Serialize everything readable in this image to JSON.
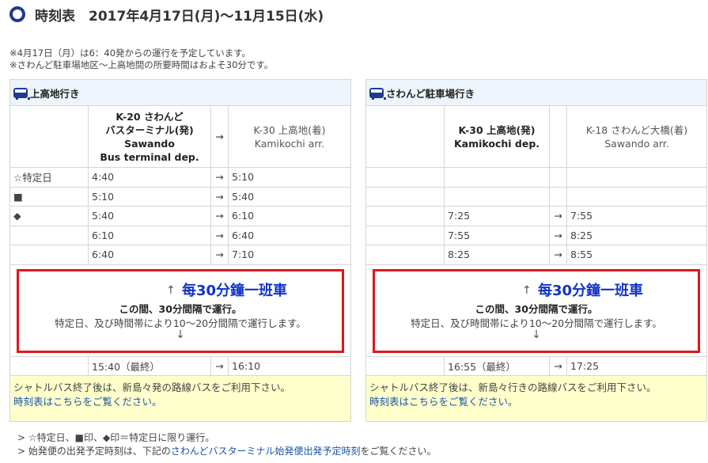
{
  "title": "時刻表　2017年4月17日(月)〜11月15日(水)",
  "notes_top": [
    "※4月17日（月）は6：40発からの運行を予定しています。",
    "※さわんど駐車場地区〜上高地間の所要時間はおよそ30分です。"
  ],
  "left": {
    "header": "上高地行き",
    "dep_col": {
      "line1": "K-20 さわんど",
      "line2": "バスターミナル(発)",
      "line3": "Sawando",
      "line4": "Bus terminal dep."
    },
    "arrow": "→",
    "arr_col": {
      "line1": "K-30 上高地(着)",
      "line2": "Kamikochi arr."
    },
    "rows": [
      {
        "mark": "☆特定日",
        "dep": "4:40",
        "arrow": "→",
        "arr": "5:10"
      },
      {
        "mark": "■",
        "dep": "5:10",
        "arrow": "→",
        "arr": "5:40"
      },
      {
        "mark": "◆",
        "dep": "5:40",
        "arrow": "→",
        "arr": "6:10"
      },
      {
        "mark": "",
        "dep": "6:10",
        "arrow": "→",
        "arr": "6:40"
      },
      {
        "mark": "",
        "dep": "6:40",
        "arrow": "→",
        "arr": "7:10"
      }
    ],
    "middle": {
      "up": "↑",
      "overlay": "每30分鐘一班車",
      "bold": "この間、30分間隔で運行。",
      "normal": "特定日、及び時間帯により10〜20分間隔で運行します。",
      "down": "↓"
    },
    "last_row": {
      "mark": "",
      "dep": "15:40（最終）",
      "arrow": "→",
      "arr": "16:10"
    },
    "footer_text": "シャトルバス終了後は、新島々発の路線バスをご利用下さい。",
    "footer_link": "時刻表はこちらをご覧ください。"
  },
  "right": {
    "header": "さわんど駐車場行き",
    "dep_col": {
      "line1": "K-30 上高地(発)",
      "line2": "Kamikochi dep."
    },
    "arrow": "",
    "arr_col": {
      "line1": "K-18 さわんど大橋(着)",
      "line2": "Sawando arr."
    },
    "rows": [
      {
        "mark": "",
        "dep": "",
        "arrow": "",
        "arr": ""
      },
      {
        "mark": "",
        "dep": "",
        "arrow": "",
        "arr": ""
      },
      {
        "mark": "",
        "dep": "7:25",
        "arrow": "→",
        "arr": "7:55"
      },
      {
        "mark": "",
        "dep": "7:55",
        "arrow": "→",
        "arr": "8:25"
      },
      {
        "mark": "",
        "dep": "8:25",
        "arrow": "→",
        "arr": "8:55"
      }
    ],
    "middle": {
      "up": "↑",
      "overlay": "每30分鐘一班車",
      "bold": "この間、30分間隔で運行。",
      "normal": "特定日、及び時間帯により10〜20分間隔で運行します。",
      "down": "↓"
    },
    "last_row": {
      "mark": "",
      "dep": "16:55（最終）",
      "arrow": "→",
      "arr": "17:25"
    },
    "footer_text": "シャトルバス終了後は、新島々行きの路線バスをご利用下さい。",
    "footer_link": "時刻表はこちらをご覧ください。"
  },
  "notes_bottom": {
    "line1": "☆特定日、■印、◆印＝特定日に限り運行。",
    "line2_pre": "始発便の出発予定時刻は、下記の",
    "line2_link": "さわんどバスターミナル始発便出発予定時刻",
    "line2_post": "をご覧ください。"
  },
  "colors": {
    "accent": "#1f3a93",
    "red_box": "#e3161a",
    "overlay_text": "#1033c8",
    "link": "#1a55a8",
    "footer_bg": "#ffffcc",
    "header_bg": "#eef4fb"
  }
}
